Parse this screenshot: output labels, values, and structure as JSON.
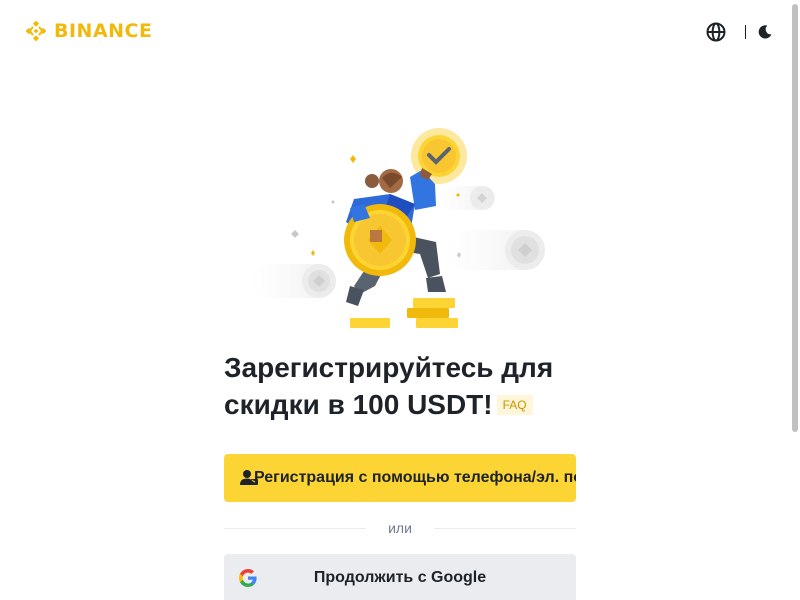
{
  "header": {
    "brand": "BINANCE",
    "language_icon": "globe-icon",
    "theme_icon": "moon-icon",
    "brand_color": "#f0b90b"
  },
  "main": {
    "title_line1": "Зарегистрируйтесь для",
    "title_line2": "скидки в 100 USDT!",
    "faq_label": "FAQ",
    "primary_button_label": "Регистрация с помощью телефона/эл. почты",
    "primary_button_icon": "user-icon",
    "divider_text": "или",
    "google_button_label": "Продолжить с Google",
    "google_button_icon": "google-icon"
  },
  "colors": {
    "accent": "#fcd535",
    "text": "#1e2329",
    "secondary_text": "#707a8a",
    "google_button_bg": "#eaecef"
  }
}
